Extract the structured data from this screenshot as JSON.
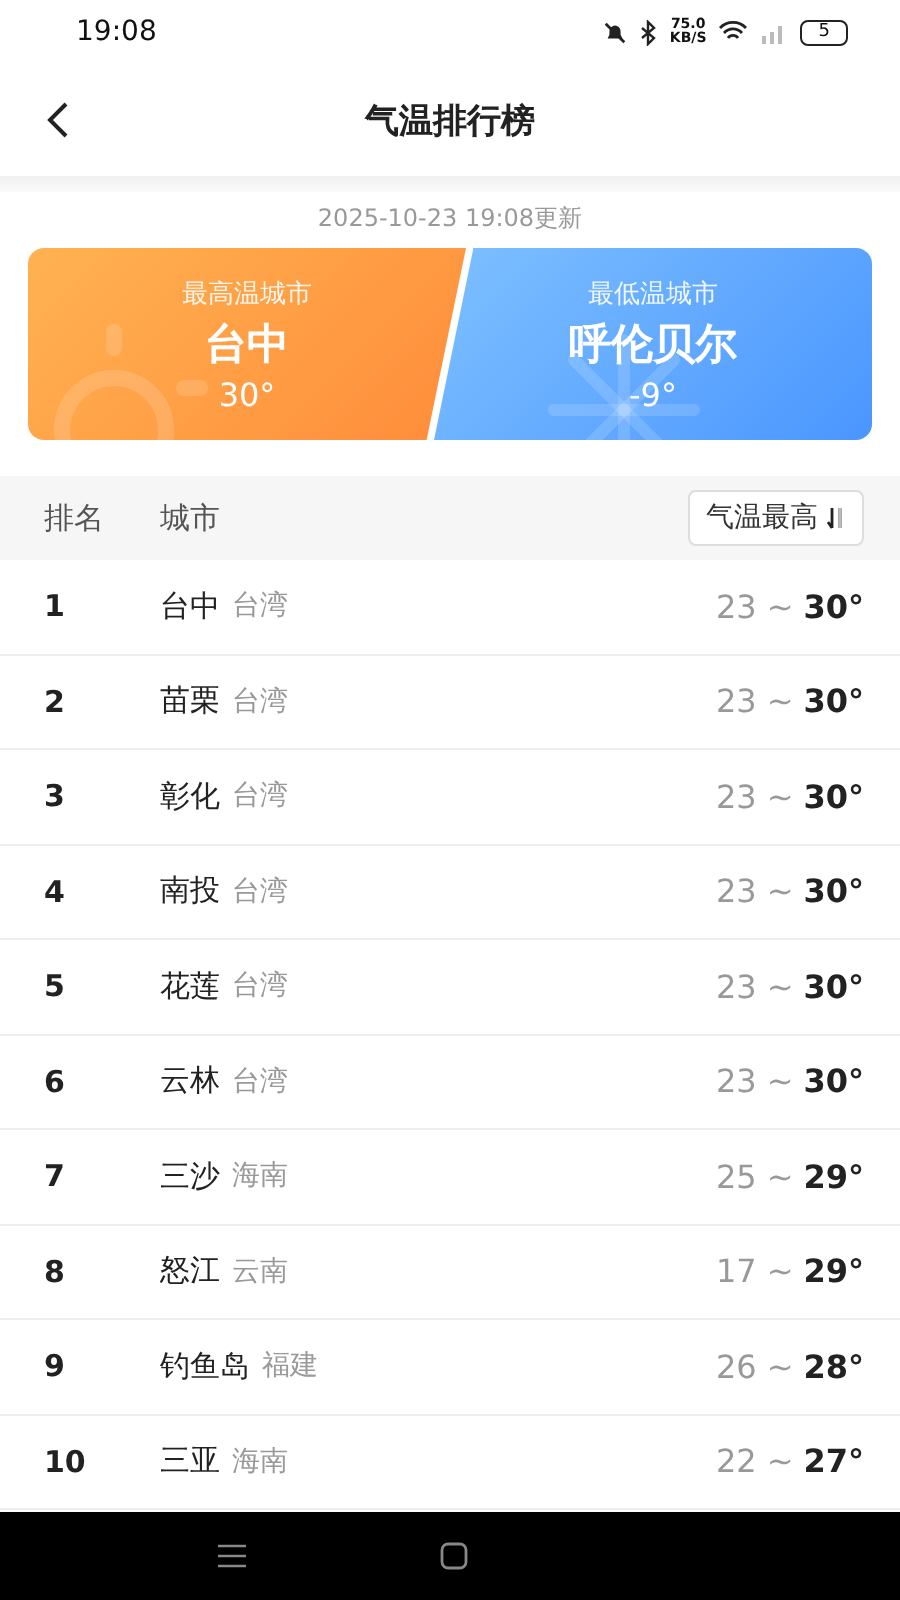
{
  "status_bar": {
    "time": "19:08",
    "speed": "75.0",
    "speed_unit": "KB/S",
    "battery": "5"
  },
  "header": {
    "title": "气温排行榜"
  },
  "updated": "2025-10-23 19:08更新",
  "cards": [
    {
      "kind": "hot",
      "label": "最高温城市",
      "city": "台中",
      "temp": "30°"
    },
    {
      "kind": "cold",
      "label": "最低温城市",
      "city": "呼伦贝尔",
      "temp": "-9°"
    }
  ],
  "table": {
    "columns": [
      "排名",
      "城市"
    ],
    "sort": {
      "label": "气温最高"
    },
    "rows": [
      {
        "rank": "1",
        "city": "台中",
        "province": "台湾",
        "low": "23",
        "sep": "~",
        "high": "30°"
      },
      {
        "rank": "2",
        "city": "苗栗",
        "province": "台湾",
        "low": "23",
        "sep": "~",
        "high": "30°"
      },
      {
        "rank": "3",
        "city": "彰化",
        "province": "台湾",
        "low": "23",
        "sep": "~",
        "high": "30°"
      },
      {
        "rank": "4",
        "city": "南投",
        "province": "台湾",
        "low": "23",
        "sep": "~",
        "high": "30°"
      },
      {
        "rank": "5",
        "city": "花莲",
        "province": "台湾",
        "low": "23",
        "sep": "~",
        "high": "30°"
      },
      {
        "rank": "6",
        "city": "云林",
        "province": "台湾",
        "low": "23",
        "sep": "~",
        "high": "30°"
      },
      {
        "rank": "7",
        "city": "三沙",
        "province": "海南",
        "low": "25",
        "sep": "~",
        "high": "29°"
      },
      {
        "rank": "8",
        "city": "怒江",
        "province": "云南",
        "low": "17",
        "sep": "~",
        "high": "29°"
      },
      {
        "rank": "9",
        "city": "钓鱼岛",
        "province": "福建",
        "low": "26",
        "sep": "~",
        "high": "28°"
      },
      {
        "rank": "10",
        "city": "三亚",
        "province": "海南",
        "low": "22",
        "sep": "~",
        "high": "27°"
      }
    ]
  }
}
